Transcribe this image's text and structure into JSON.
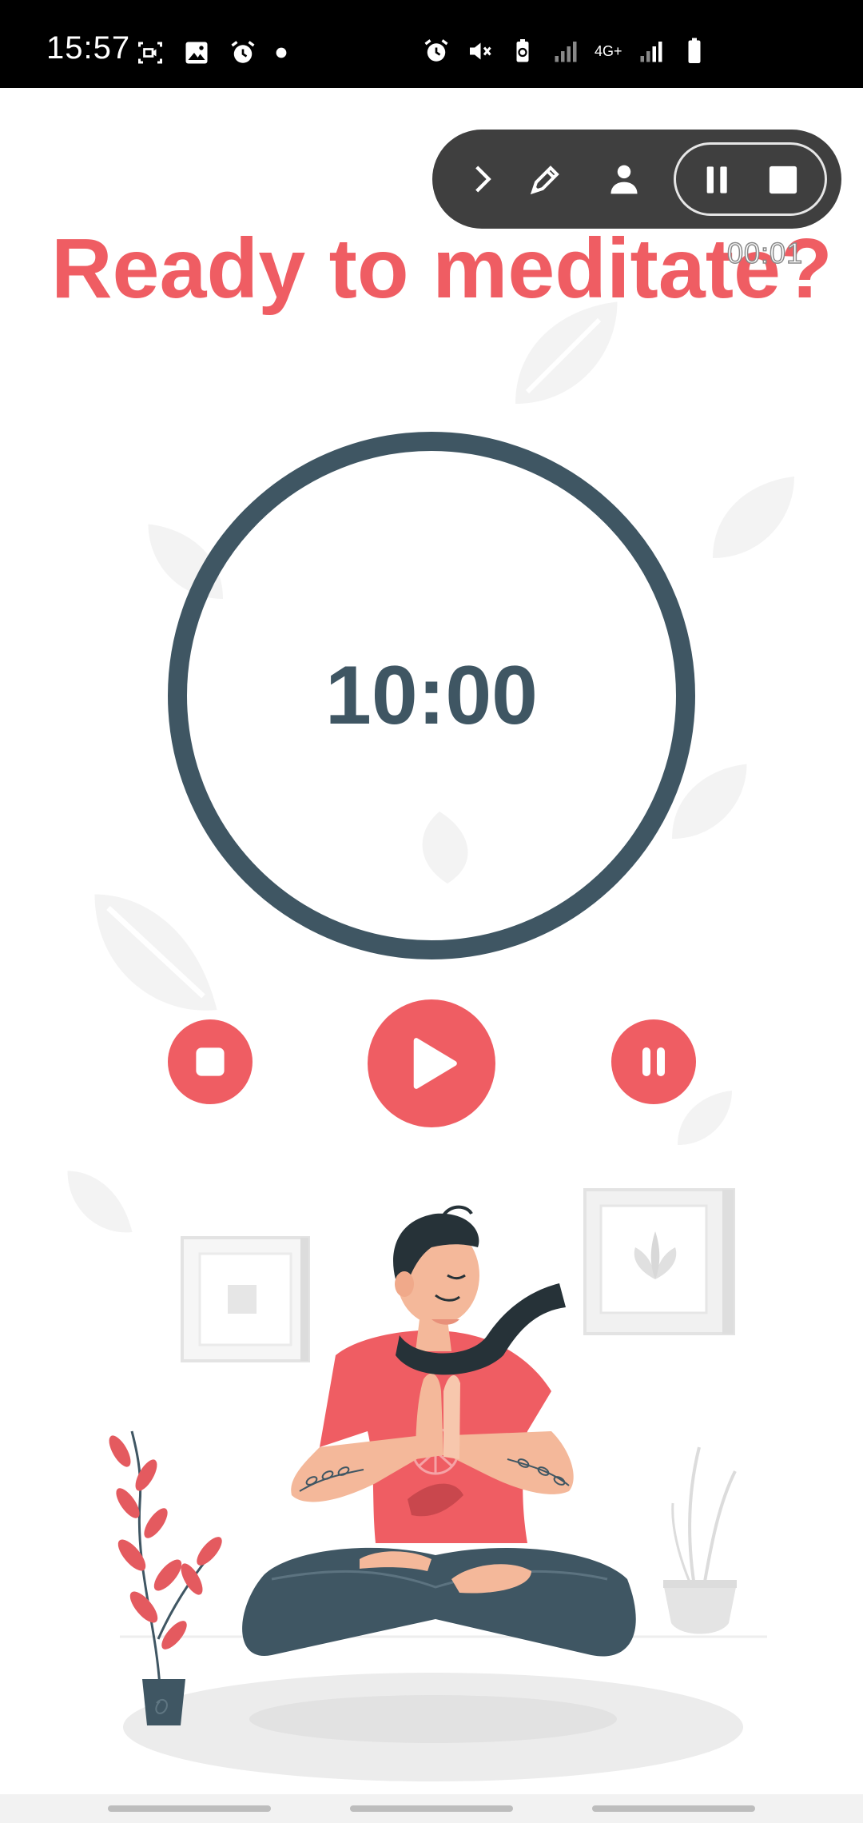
{
  "status_bar": {
    "time": "15:57",
    "network": "4G+",
    "icons_left": [
      "screen-record-icon",
      "image-icon",
      "alarm-icon",
      "dot-icon"
    ],
    "icons_right": [
      "alarm-icon",
      "mute-icon",
      "battery-saver-icon",
      "signal-icon",
      "4g-icon",
      "signal-icon",
      "battery-icon"
    ]
  },
  "recorder": {
    "timer": "00:01",
    "icons": [
      "chevron-right-icon",
      "pen-icon",
      "person-icon",
      "pause-icon",
      "stop-icon"
    ]
  },
  "page": {
    "title": "Ready to meditate?"
  },
  "timer": {
    "display": "10:00"
  },
  "controls": {
    "stop_icon": "stop-icon",
    "play_icon": "play-icon",
    "pause_icon": "pause-icon"
  },
  "colors": {
    "accent": "#ef5d63",
    "timer": "#3f5663",
    "toolbar": "#3f3f3f"
  },
  "illustration": {
    "name": "meditating-man-illustration"
  }
}
